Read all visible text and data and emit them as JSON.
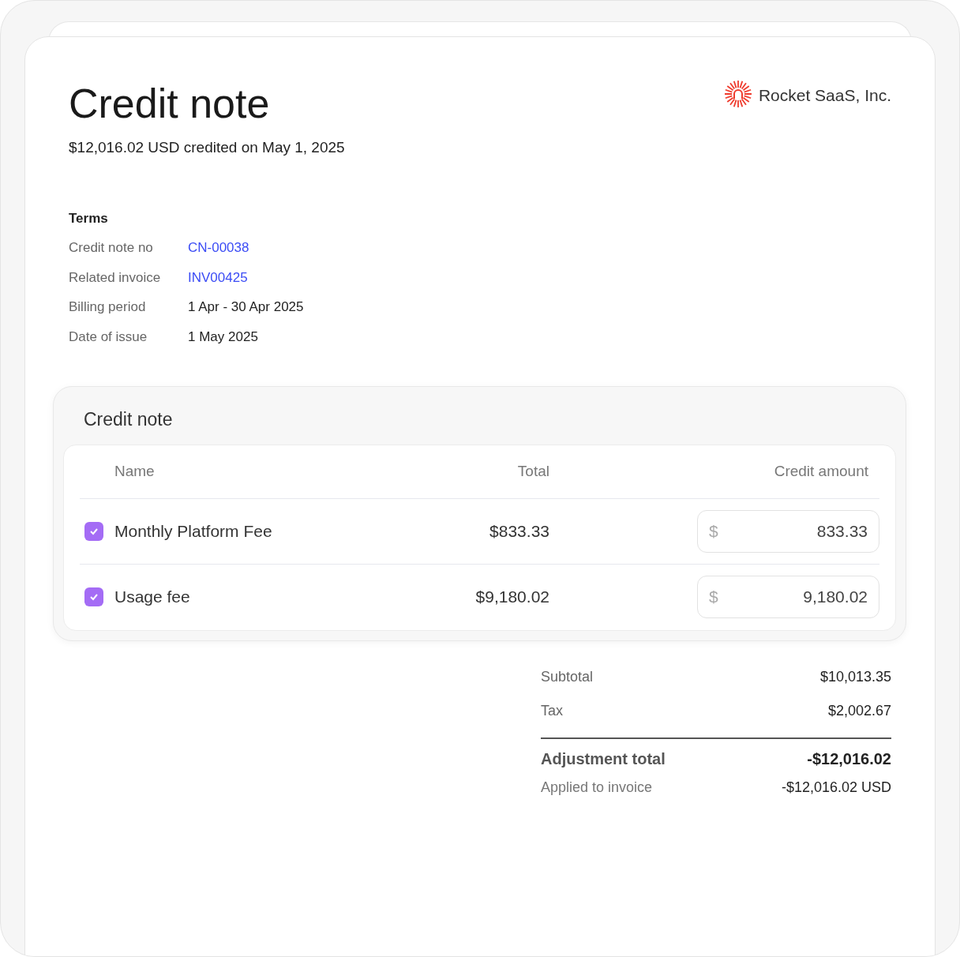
{
  "header": {
    "title": "Credit note",
    "subtitle": "$12,016.02 USD credited on May 1, 2025",
    "company": "Rocket SaaS, Inc."
  },
  "terms": {
    "heading": "Terms",
    "rows": [
      {
        "label": "Credit note no",
        "value": "CN-00038",
        "kind": "link"
      },
      {
        "label": "Related invoice",
        "value": "INV00425",
        "kind": "link"
      },
      {
        "label": "Billing period",
        "value": "1 Apr - 30 Apr 2025",
        "kind": "text"
      },
      {
        "label": "Date of issue",
        "value": "1 May 2025",
        "kind": "text"
      }
    ]
  },
  "credit_table": {
    "title": "Credit note",
    "columns": [
      "Name",
      "Total",
      "Credit amount"
    ],
    "rows": [
      {
        "checked": true,
        "name": "Monthly Platform Fee",
        "total": "$833.33",
        "currency": "$",
        "amount": "833.33"
      },
      {
        "checked": true,
        "name": "Usage fee",
        "total": "$9,180.02",
        "currency": "$",
        "amount": "9,180.02"
      }
    ]
  },
  "summary": {
    "rows": [
      {
        "label": "Subtotal",
        "value": "$10,013.35"
      },
      {
        "label": "Tax",
        "value": "$2,002.67"
      }
    ],
    "total": {
      "label": "Adjustment total",
      "value": "-$12,016.02"
    },
    "applied": {
      "label": "Applied to invoice",
      "value": "-$12,016.02 USD"
    }
  }
}
